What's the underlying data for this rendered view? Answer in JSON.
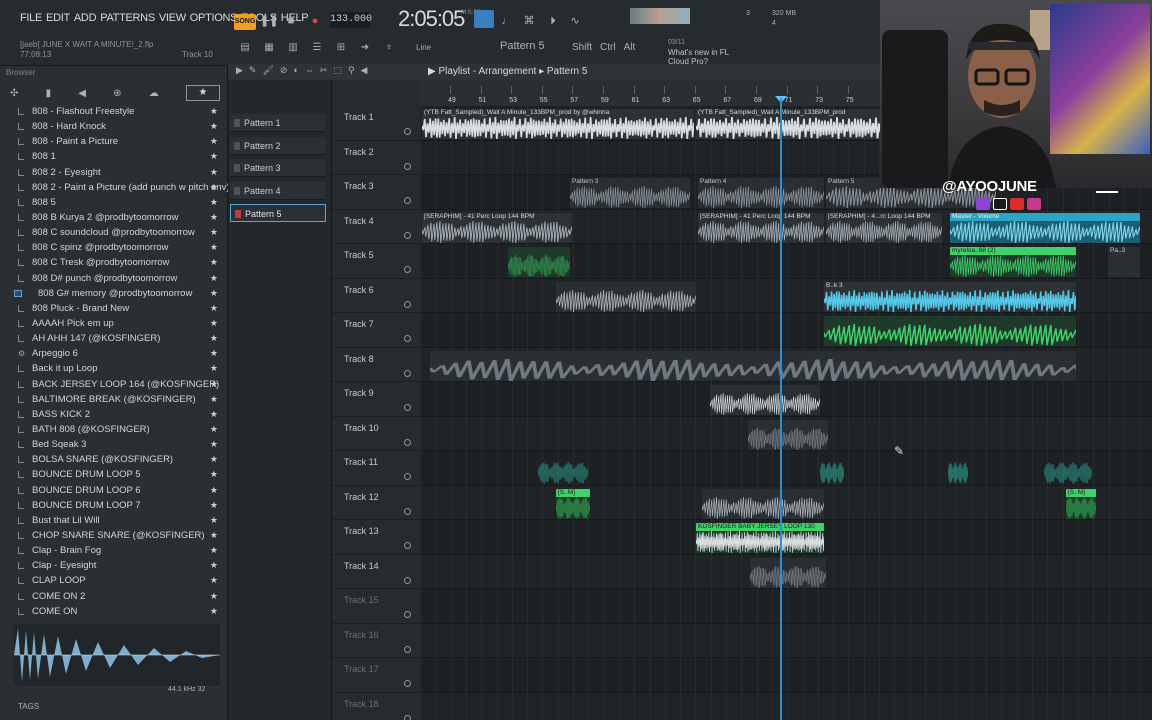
{
  "menu": [
    "FILE",
    "EDIT",
    "ADD",
    "PATTERNS",
    "VIEW",
    "OPTIONS",
    "TOOLS",
    "HELP"
  ],
  "project": {
    "title": "[jaeb] JUNE X WAIT A MINUTE!_2.flp",
    "time": "77:08:13",
    "track_hint": "Track 10"
  },
  "transport": {
    "mode": "SONG",
    "tempo": "133.000",
    "clock": "2:05:05",
    "clock_sub": "M:S:CS",
    "pattern": "Pattern 5",
    "snap": "Line",
    "cpu_a": "3",
    "cpu_b": "320 MB",
    "cpu_c": "4"
  },
  "keys": [
    "Shift",
    "Ctrl",
    "Alt"
  ],
  "news": {
    "date": "03/11",
    "text1": "What's new in FL",
    "text2": "Cloud Pro?"
  },
  "browser": {
    "title": "Browser",
    "items": [
      {
        "label": "808 - Flashout Freestyle",
        "kind": "file"
      },
      {
        "label": "808 - Hard Knock",
        "kind": "file"
      },
      {
        "label": "808 - Paint a Picture",
        "kind": "file"
      },
      {
        "label": "808 1",
        "kind": "file"
      },
      {
        "label": "808 2 - Eyesight",
        "kind": "file"
      },
      {
        "label": "808 2 - Paint a Picture (add punch w pitch env)",
        "kind": "file"
      },
      {
        "label": "808 5",
        "kind": "file"
      },
      {
        "label": "808 B Kurya 2 @prodbytoomorrow",
        "kind": "file"
      },
      {
        "label": "808 C soundcloud @prodbytoomorrow",
        "kind": "file"
      },
      {
        "label": "808 C spinz @prodbytoomorrow",
        "kind": "file"
      },
      {
        "label": "808 C Tresk @prodbytoomorrow",
        "kind": "file"
      },
      {
        "label": "808 D# punch @prodbytoomorrow",
        "kind": "file"
      },
      {
        "label": "808 G# memory @prodbytoomorrow",
        "kind": "folder"
      },
      {
        "label": "808 Pluck - Brand New",
        "kind": "file"
      },
      {
        "label": "AAAAH Pick em up",
        "kind": "file"
      },
      {
        "label": "AH AHH 147 (@KOSFINGER)",
        "kind": "file"
      },
      {
        "label": "Arpeggio 6",
        "kind": "gear"
      },
      {
        "label": "Back it up Loop",
        "kind": "file"
      },
      {
        "label": "BACK JERSEY LOOP 164 (@KOSFINGER)",
        "kind": "file"
      },
      {
        "label": "BALTIMORE BREAK (@KOSFINGER)",
        "kind": "file"
      },
      {
        "label": "BASS KICK 2",
        "kind": "file"
      },
      {
        "label": "BATH 808 (@KOSFINGER)",
        "kind": "file"
      },
      {
        "label": "Bed Sqeak 3",
        "kind": "file"
      },
      {
        "label": "BOLSA SNARE (@KOSFINGER)",
        "kind": "file"
      },
      {
        "label": "BOUNCE DRUM LOOP 5",
        "kind": "file"
      },
      {
        "label": "BOUNCE DRUM LOOP 6",
        "kind": "file"
      },
      {
        "label": "BOUNCE DRUM LOOP 7",
        "kind": "file"
      },
      {
        "label": "Bust that Lil Will",
        "kind": "file"
      },
      {
        "label": "CHOP SNARE SNARE (@KOSFINGER)",
        "kind": "file"
      },
      {
        "label": "Clap - Brain Fog",
        "kind": "file"
      },
      {
        "label": "Clap - Eyesight",
        "kind": "file"
      },
      {
        "label": "CLAP LOOP",
        "kind": "file"
      },
      {
        "label": "COME ON 2",
        "kind": "file"
      },
      {
        "label": "COME ON",
        "kind": "file"
      }
    ],
    "sample_info": "44.1 kHz 32",
    "tags_label": "TAGS"
  },
  "playlist": {
    "title": "Playlist - Arrangement",
    "pattern": "Pattern 5",
    "patterns": [
      "Pattern 1",
      "Pattern 2",
      "Pattern 3",
      "Pattern 4",
      "Pattern 5"
    ],
    "selected_pattern": 4,
    "tracks": [
      "Track 1",
      "Track 2",
      "Track 3",
      "Track 4",
      "Track 5",
      "Track 6",
      "Track 7",
      "Track 8",
      "Track 9",
      "Track 10",
      "Track 11",
      "Track 12",
      "Track 13",
      "Track 14",
      "Track 15",
      "Track 16",
      "Track 17",
      "Track 18"
    ],
    "bar_numbers": [
      "49",
      "51",
      "53",
      "55",
      "57",
      "59",
      "61",
      "63",
      "65",
      "67",
      "69",
      "71",
      "73",
      "75"
    ]
  },
  "clips": {
    "c1": "(YTB Fatt_Sampled)_Wait A Minute_133BPM_prod by @whinna",
    "c2": "(YTB Fatt_Sampled)_Wait A Minute_133BPM_prod",
    "p3": "Pattern 3",
    "p4": "Pattern 4",
    "p5": "Pattern 5",
    "s1": "[SERAPHIM] - 41 Perc Loop 144 BPM",
    "s2": "[SERAPHIM] - 41 Perc Loop 144 BPM",
    "s3": "[SERAPHIM] - 4...rc Loop 144 BPM",
    "mv": "Master - Volume",
    "my1": "myreloa..68 (2)",
    "my2": "myreloa..68 (2)",
    "pa": "Pa..3",
    "bk": "B..k 3",
    "sm1": "[S..M]",
    "sm2": "[S..M]",
    "kos": "KOSFINGER BABY JERSEY LOOP 130"
  },
  "overlay": {
    "handle": "@AYOOJUNE"
  },
  "colors": {
    "accent": "#3fd26a",
    "playhead": "#2d8fd1",
    "song": "#f0a020"
  }
}
